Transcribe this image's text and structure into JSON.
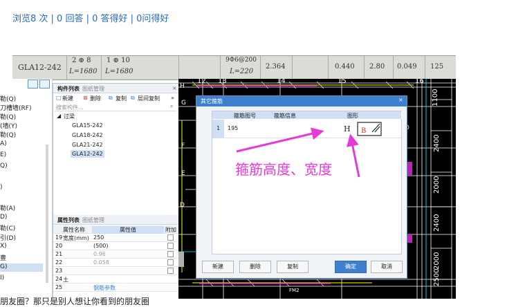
{
  "page": {
    "stats_text": "浏览8 次 | 0 回答 | 0 答得好 | 0问得好",
    "bottom_text": "朋友圈？那只是别人想让你看到的朋友圈"
  },
  "table_strip": {
    "row_label": "GLA12-242",
    "c1_top": "2 ⊕ 8",
    "c1_bottom": "L=1680",
    "c2_top": "1 ⊕ 10",
    "c2_bottom": "L=1680",
    "c3_top": "9Φ6@200",
    "c3_bottom": "L=220",
    "v1": "2.364",
    "v2": "0.440",
    "v3": "2.80",
    "v4": "0.049",
    "v5": "125"
  },
  "left_nav": {
    "items": [
      "勒(Q)",
      "刀槽墙(RF)",
      "勒(Q)",
      "(墙(Y)",
      "勒(Q)",
      "A)",
      "E)",
      "Q)",
      ")",
      "勒(A)",
      "D)",
      "勒(C)",
      "引(D)",
      "X)",
      "豊",
      "G)",
      "I)"
    ]
  },
  "component_panel": {
    "tab_active": "构件列表",
    "tab_inactive": "图纸管理",
    "toolbar": [
      "新建",
      "删除",
      "复制",
      "层间复制"
    ],
    "search_placeholder": "搜索构件...",
    "group": "过梁",
    "items": [
      "GLA15-242",
      "GLA18-242",
      "GLA21-242",
      "GLA12-242"
    ]
  },
  "property_panel": {
    "tab_active": "属性列表",
    "tab_inactive": "图纸管理",
    "col_name": "属性名称",
    "col_value": "属性值",
    "col_extra": "附加",
    "rows": [
      {
        "no": "19",
        "name": "宽度(mm)",
        "value": "250"
      },
      {
        "no": "20",
        "name": "",
        "value": "(500)"
      },
      {
        "no": "21",
        "name": "",
        "value": "0.96"
      },
      {
        "no": "22",
        "name": "",
        "value": "0.058"
      },
      {
        "no": "23",
        "name": "",
        "value": ""
      },
      {
        "no": "24",
        "name": "土",
        "value": ""
      },
      {
        "no": "25",
        "name": "",
        "value": "钢筋参数"
      }
    ]
  },
  "cad": {
    "axis_top": [
      "12",
      "13",
      "14",
      "15",
      "16"
    ],
    "axis_left": [
      "H",
      "G",
      "F",
      "E",
      "D"
    ],
    "dims_right": [
      "1100",
      "2400",
      "2000",
      "2400",
      "2000",
      "2500"
    ],
    "bottom_label": "FM2"
  },
  "dialog": {
    "title": "其它箍筋",
    "headers": [
      "箍筋图号",
      "箍筋信息",
      "图形"
    ],
    "row_no": "1",
    "row_code": "195",
    "shape_h": "H",
    "shape_b": "B",
    "buttons": [
      "新建",
      "删除",
      "复制",
      "确定",
      "取消"
    ]
  },
  "annotation": {
    "text": "箍筋高度、宽度",
    "color": "#e53ad9"
  }
}
